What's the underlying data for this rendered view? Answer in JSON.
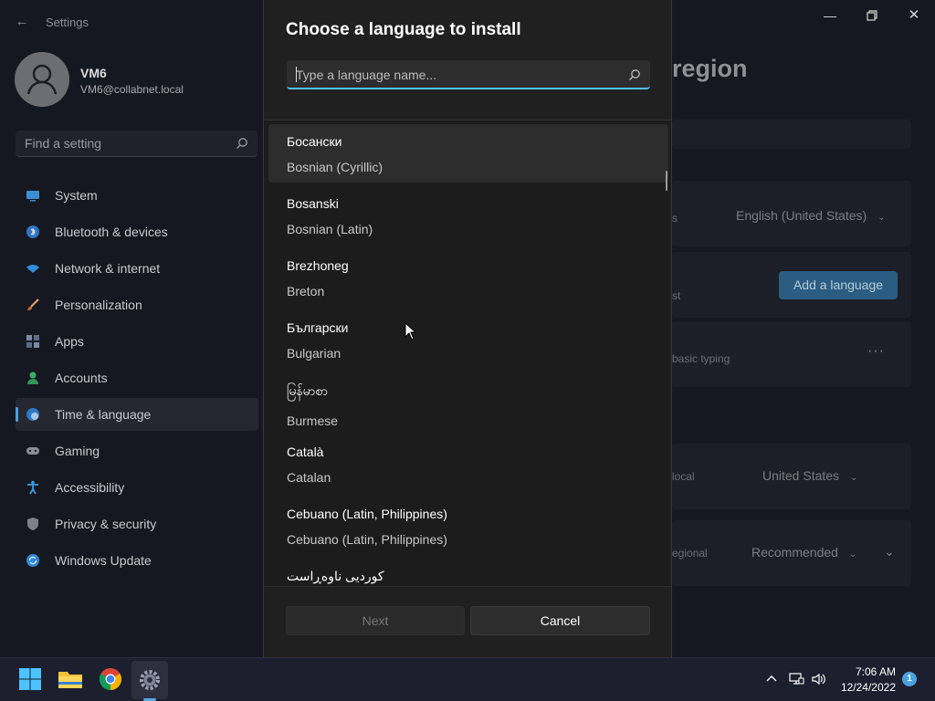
{
  "window": {
    "app_title": "Settings",
    "back_icon": "back-arrow-icon",
    "controls": [
      "minimize-icon",
      "restore-icon",
      "close-icon"
    ]
  },
  "user": {
    "name": "VM6",
    "email": "VM6@collabnet.local"
  },
  "search": {
    "placeholder": "Find a setting"
  },
  "sidebar": {
    "items": [
      {
        "label": "System",
        "icon": "monitor-icon"
      },
      {
        "label": "Bluetooth & devices",
        "icon": "bluetooth-icon"
      },
      {
        "label": "Network & internet",
        "icon": "wifi-icon"
      },
      {
        "label": "Personalization",
        "icon": "brush-icon"
      },
      {
        "label": "Apps",
        "icon": "apps-icon"
      },
      {
        "label": "Accounts",
        "icon": "person-icon"
      },
      {
        "label": "Time & language",
        "icon": "globe-clock-icon",
        "active": true
      },
      {
        "label": "Gaming",
        "icon": "gamepad-icon"
      },
      {
        "label": "Accessibility",
        "icon": "accessibility-icon"
      },
      {
        "label": "Privacy & security",
        "icon": "shield-icon"
      },
      {
        "label": "Windows Update",
        "icon": "update-icon"
      }
    ]
  },
  "background_page": {
    "heading_fragment": "region",
    "windows_display_language_value": "English (United States)",
    "preferred_fragment": "st",
    "add_language_label": "Add a language",
    "language_sub_fragment": "basic typing",
    "more_label": "···",
    "region_fragment": "local",
    "country_value": "United States",
    "regional_format_fragment": "egional",
    "regional_format_value": "Recommended",
    "text_color": "#6c6e76",
    "accent_button": "#2b5d82"
  },
  "dialog": {
    "title": "Choose a language to install",
    "search_placeholder": "Type a language name...",
    "languages": [
      {
        "native": "Босански",
        "english": "Bosnian (Cyrillic)",
        "selected": true
      },
      {
        "native": "Bosanski",
        "english": "Bosnian (Latin)"
      },
      {
        "native": "Brezhoneg",
        "english": "Breton"
      },
      {
        "native": "Български",
        "english": "Bulgarian"
      },
      {
        "native": "မြန်မာစာ",
        "english": "Burmese"
      },
      {
        "native": "Català",
        "english": "Catalan"
      },
      {
        "native": "Cebuano (Latin, Philippines)",
        "english": "Cebuano (Latin, Philippines)"
      },
      {
        "native": "کوردیی ناوەڕاست",
        "english": ""
      }
    ],
    "next_label": "Next",
    "cancel_label": "Cancel",
    "accent_color": "#4cc2ff"
  },
  "taskbar": {
    "apps": [
      "windows-start-icon",
      "file-explorer-icon",
      "chrome-icon",
      "settings-icon"
    ],
    "tray_icons": [
      "chevron-up-icon",
      "network-icon",
      "volume-icon"
    ],
    "time": "7:06 AM",
    "date": "12/24/2022",
    "notification_count": "1"
  }
}
